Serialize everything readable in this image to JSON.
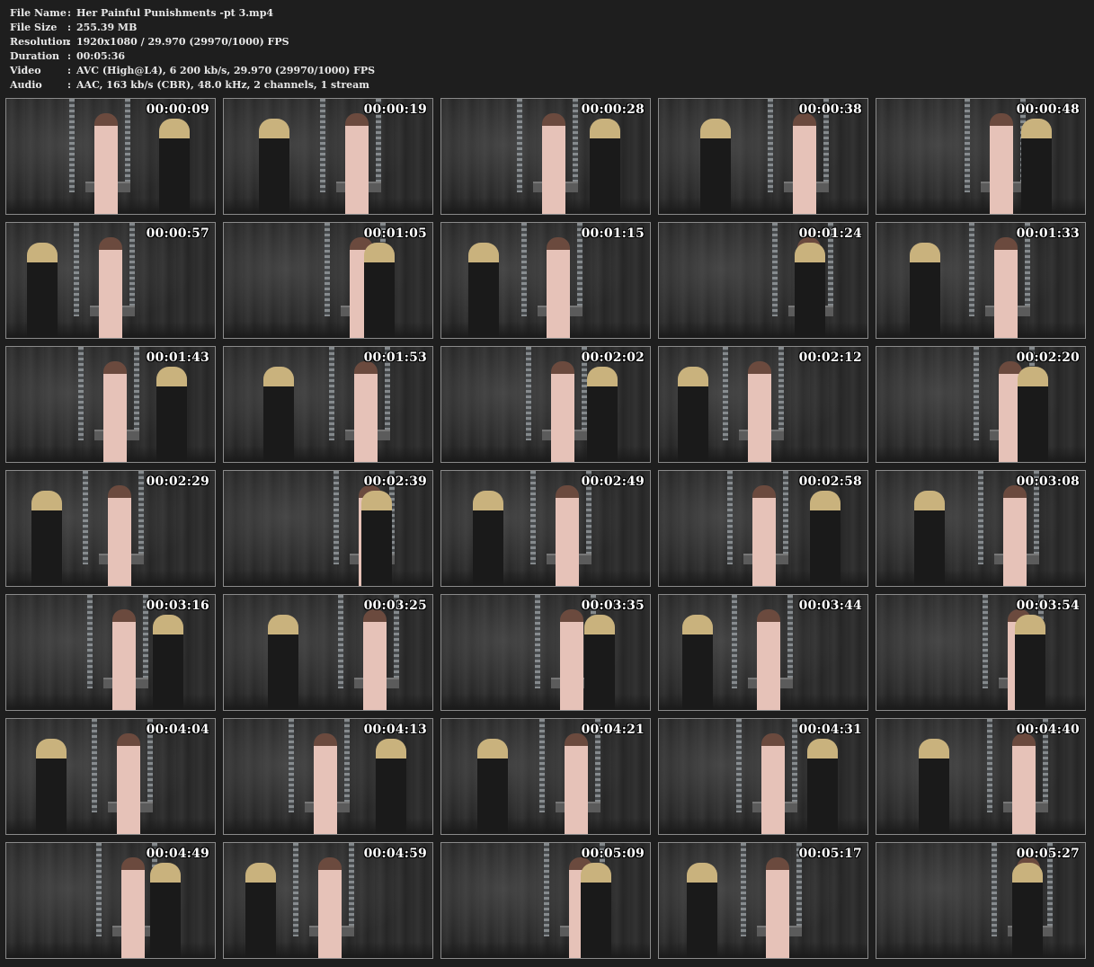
{
  "info": [
    {
      "label": "File Name",
      "value": "Her Painful Punishments -pt 3.mp4"
    },
    {
      "label": "File Size",
      "value": "255.39 MB"
    },
    {
      "label": "Resolution",
      "value": "1920x1080 / 29.970 (29970/1000) FPS"
    },
    {
      "label": "Duration",
      "value": "00:05:36"
    },
    {
      "label": "Video",
      "value": "AVC (High@L4), 6 200 kb/s, 29.970 (29970/1000) FPS"
    },
    {
      "label": "Audio",
      "value": "AAC, 163 kb/s (CBR), 48.0 kHz, 2 channels, 1 stream"
    }
  ],
  "separator": ":",
  "thumbnails": [
    "00:00:09",
    "00:00:19",
    "00:00:28",
    "00:00:38",
    "00:00:48",
    "00:00:57",
    "00:01:05",
    "00:01:15",
    "00:01:24",
    "00:01:33",
    "00:01:43",
    "00:01:53",
    "00:02:02",
    "00:02:12",
    "00:02:20",
    "00:02:29",
    "00:02:39",
    "00:02:49",
    "00:02:58",
    "00:03:08",
    "00:03:16",
    "00:03:25",
    "00:03:35",
    "00:03:44",
    "00:03:54",
    "00:04:04",
    "00:04:13",
    "00:04:21",
    "00:04:31",
    "00:04:40",
    "00:04:49",
    "00:04:59",
    "00:05:09",
    "00:05:17",
    "00:05:27"
  ]
}
